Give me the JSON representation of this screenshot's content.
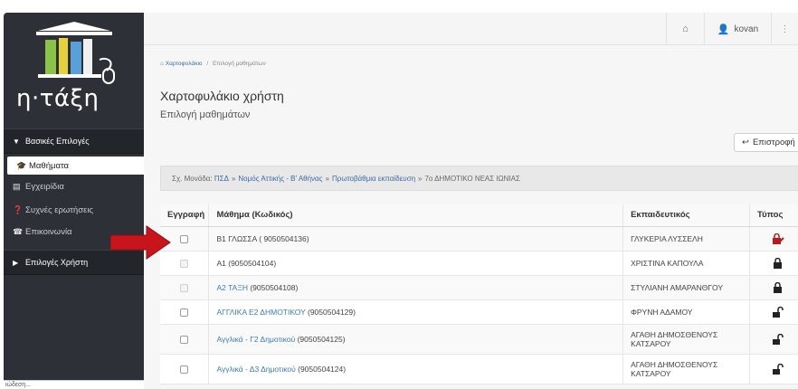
{
  "brand": {
    "logo_text": "η·τάξη"
  },
  "sidebar": {
    "basic_section": "Βασικές Επιλογές",
    "items": [
      {
        "label": "Μαθήματα",
        "icon": "graduation-cap-icon"
      },
      {
        "label": "Εγχειρίδια",
        "icon": "book-icon"
      },
      {
        "label": "Συχνές ερωτήσεις",
        "icon": "question-circle-icon"
      },
      {
        "label": "Επικοινωνία",
        "icon": "phone-icon"
      }
    ],
    "user_section": "Επιλογές Χρήστη",
    "bottom_text": "ιώδεση..."
  },
  "topbar": {
    "home_icon": "home-icon",
    "user_icon": "user-icon",
    "username": "kovan"
  },
  "breadcrumb": {
    "home": "Χαρτοφυλάκιο",
    "separator": "/",
    "current": "Επιλογή μαθημάτων"
  },
  "page": {
    "title": "Χαρτοφυλάκιο χρήστη",
    "subtitle": "Επιλογή μαθημάτων",
    "back_button": "Επιστροφή"
  },
  "school_bar": {
    "prefix": "Σχ. Μονάδα:",
    "path": [
      "ΠΣΔ",
      "Νομός Αττικής - Β' Αθήνας",
      "Πρωτοβάθμια εκπαίδευση"
    ],
    "sep": "»",
    "school": "7ο ΔΗΜΟΤΙΚΟ ΝΕΑΣ ΙΩΝΙΑΣ"
  },
  "table": {
    "headers": {
      "enroll": "Εγγραφή",
      "lesson": "Μάθημα (Κωδικός)",
      "teacher": "Εκπαιδευτικός",
      "type": "Τύπος"
    },
    "rows": [
      {
        "lesson": "Β1 ΓΛΩΣΣΑ ( 9050504136)",
        "teacher": "ΓΛΥΚΕΡΙΑ ΛΥΣΣΕΛΗ",
        "type_icon": "lock-pencil-icon",
        "checkbox_enabled": true
      },
      {
        "lesson": "Α1 (9050504104)",
        "teacher": "ΧΡΙΣΤΙΝΑ ΚΑΠΟΥΛΑ",
        "type_icon": "lock-icon",
        "checkbox_enabled": false
      },
      {
        "lesson_link": "Α2 ΤΑΞΗ",
        "lesson_code": " (9050504108)",
        "teacher": "ΣΤΥΛΙΑΝΗ ΑΜΑΡΑΝΘΓΟΥ",
        "type_icon": "lock-icon",
        "checkbox_enabled": false
      },
      {
        "lesson_link": "ΑΓΓΛΙΚΑ Ε2 ΔΗΜΟΤΙΚΟΥ",
        "lesson_code": " (9050504129)",
        "teacher": "ΦΡΥΝΗ ΑΔΑΜΟΥ",
        "type_icon": "unlock-icon",
        "checkbox_enabled": true
      },
      {
        "lesson_link": "Αγγλικά - Γ2 Δημοτικού",
        "lesson_code": " (9050504125)",
        "teacher_line1": "ΑΓΑΘΗ ΔΗΜΟΣΘΕΝΟΥΣ",
        "teacher_line2": "ΚΑΤΣΑΡΟΥ",
        "type_icon": "unlock-icon",
        "checkbox_enabled": true
      },
      {
        "lesson_link": "Αγγλικά - Δ3 Δημοτικού",
        "lesson_code": " (9050504124)",
        "teacher_line1": "ΑΓΑΘΗ ΔΗΜΟΣΘΕΝΟΥΣ",
        "teacher_line2": "ΚΑΤΣΑΡΟΥ",
        "type_icon": "unlock-icon",
        "checkbox_enabled": true
      }
    ]
  },
  "colors": {
    "sidebar_bg": "#2d3036",
    "link": "#3d7bb6",
    "arrow": "#c8141b"
  }
}
